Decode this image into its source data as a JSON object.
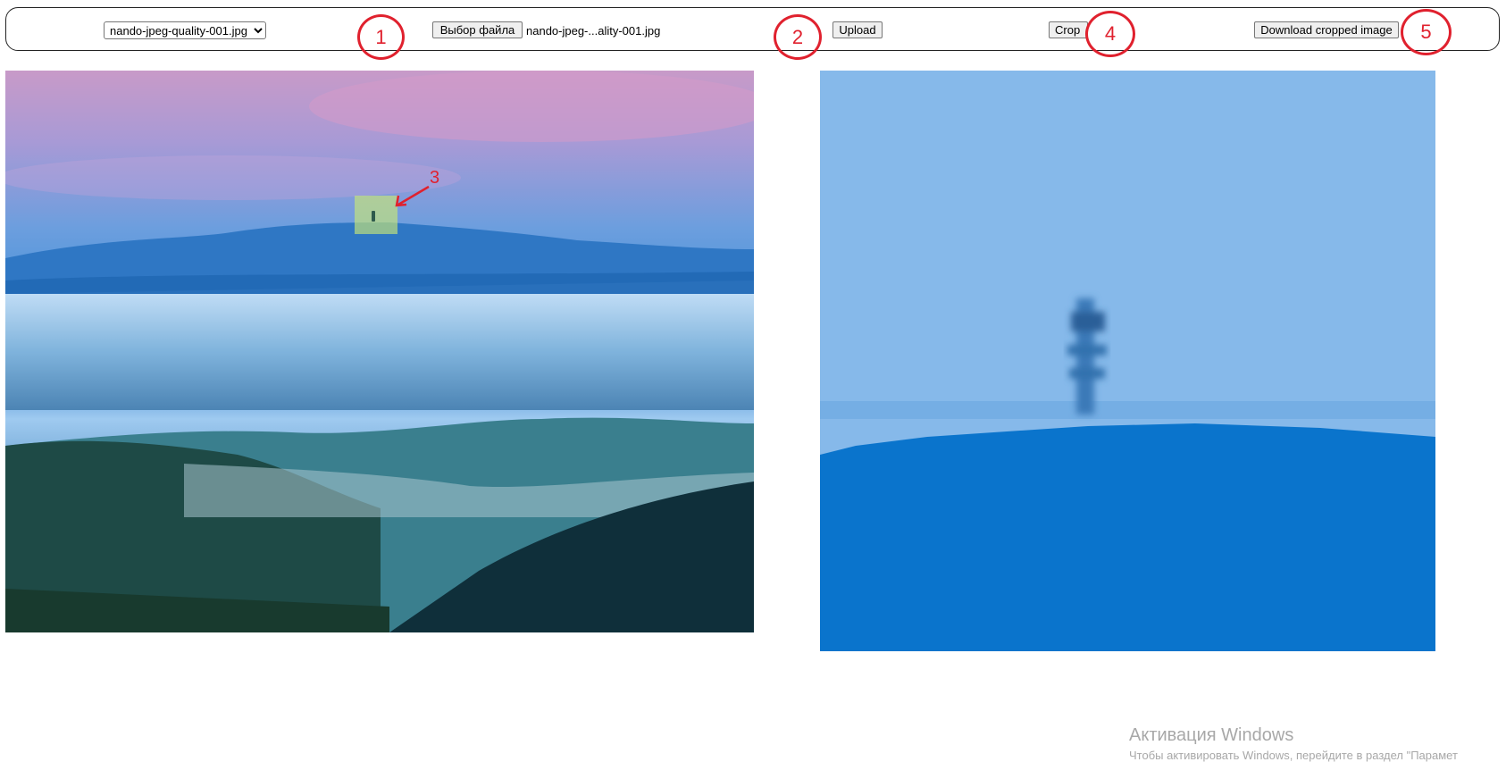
{
  "toolbar": {
    "select": {
      "selected": "nando-jpeg-quality-001.jpg",
      "options": [
        "nando-jpeg-quality-001.jpg"
      ]
    },
    "choose_file_label": "Выбор файла",
    "file_name": "nando-jpeg-...ality-001.jpg",
    "upload_label": "Upload",
    "crop_label": "Crop",
    "download_label": "Download cropped image"
  },
  "annotations": {
    "m1": "1",
    "m2": "2",
    "m3": "3",
    "m4": "4",
    "m5": "5"
  },
  "watermark": {
    "title": "Активация Windows",
    "subtitle": "Чтобы активировать Windows, перейдите в раздел \"Парамет"
  },
  "colors": {
    "annotation": "#e0212e",
    "zoom_sky": "#86b9ea",
    "zoom_ground": "#0a74cc",
    "crop_overlay": "#c8e678"
  }
}
